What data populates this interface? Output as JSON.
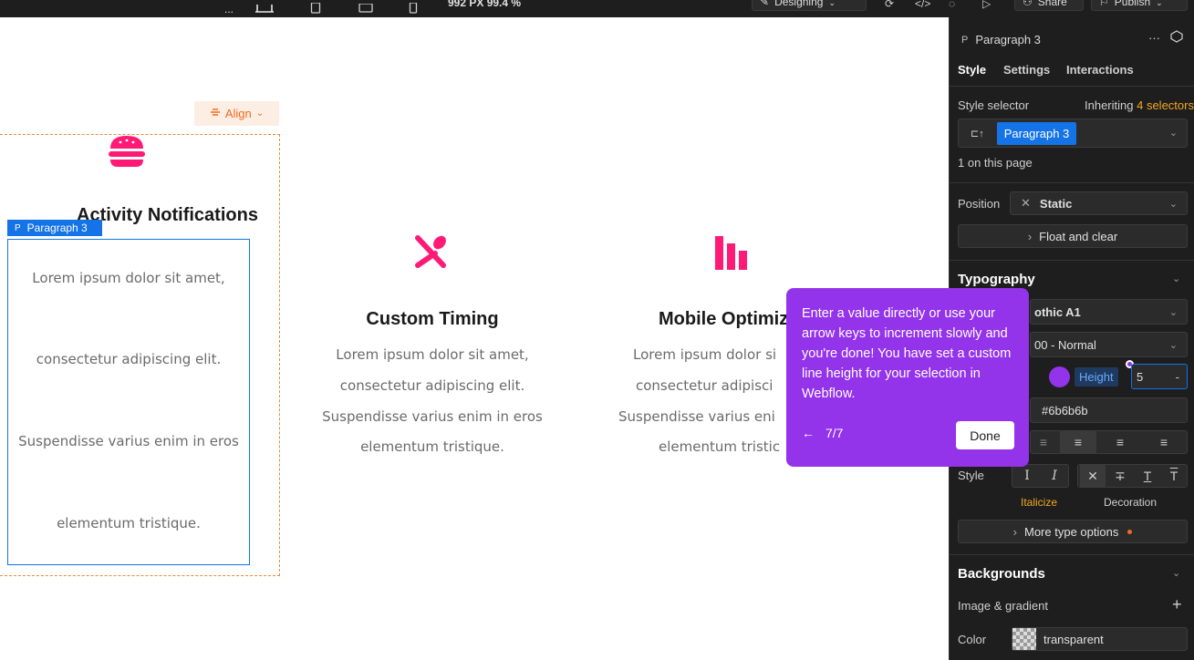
{
  "topbar": {
    "more_label": "...",
    "viewport_info": "992 PX  99.4 %",
    "mode_label": "Designing",
    "share_label": "Share",
    "publish_label": "Publish"
  },
  "canvas": {
    "align_label": "Align",
    "col1": {
      "title": "Activity Notifications",
      "element_label": "Paragraph 3",
      "element_tag": "P",
      "lines": [
        "Lorem ipsum dolor sit amet,",
        "consectetur adipiscing elit.",
        "Suspendisse varius enim in eros",
        "elementum tristique."
      ]
    },
    "col2": {
      "title": "Custom Timing",
      "lines": [
        "Lorem ipsum dolor sit amet,",
        "consectetur adipiscing elit.",
        "Suspendisse varius enim in eros",
        "elementum tristique."
      ]
    },
    "col3": {
      "title": "Mobile Optimiz",
      "lines": [
        "Lorem ipsum dolor si",
        "consectetur adipisci",
        "Suspendisse varius eni",
        "elementum tristic"
      ]
    }
  },
  "tooltip": {
    "text": "Enter a value directly or use your arrow keys to increment slowly and you're done! You have set a custom line height for your selection in Webflow.",
    "step": "7/7",
    "back_arrow": "←",
    "done_label": "Done"
  },
  "panel": {
    "element_tag": "P",
    "element_name": "Paragraph 3",
    "more": "···",
    "tabs": [
      "Style",
      "Settings",
      "Interactions"
    ],
    "style_selector_label": "Style selector",
    "inheriting_prefix": "Inheriting",
    "inheriting_count": "4 selectors",
    "selector_chip": "Paragraph 3",
    "on_page": "1 on this page",
    "position_label": "Position",
    "position_value": "Static",
    "float_clear": "Float and clear",
    "typography_title": "Typography",
    "font_value": "othic A1",
    "weight_value": "00 - Normal",
    "height_label": "Height",
    "height_value": "5",
    "height_unit": "-",
    "color_value": "#6b6b6b",
    "style_label": "Style",
    "italicize_label": "Italicize",
    "decoration_label": "Decoration",
    "more_type": "More type options",
    "backgrounds_title": "Backgrounds",
    "image_gradient": "Image & gradient",
    "add": "+",
    "color_label": "Color",
    "bg_color_value": "transparent"
  },
  "colors": {
    "accent_pink": "#ff1a75",
    "selection_blue": "#1473e6",
    "tooltip_purple": "#9333ea",
    "orange": "#f26a21"
  }
}
